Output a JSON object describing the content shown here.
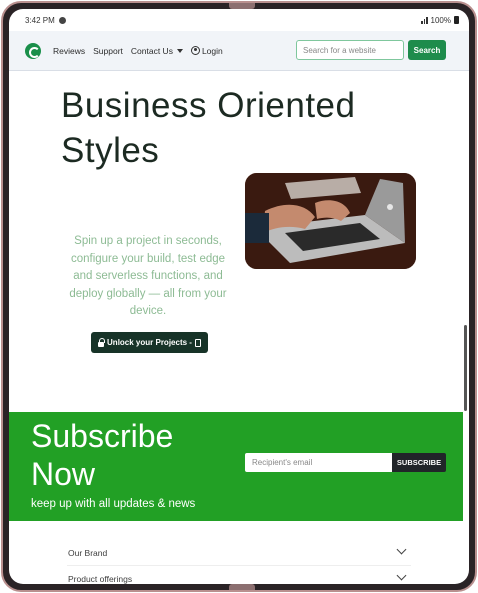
{
  "status_bar": {
    "time": "3:42 PM",
    "battery": "100%"
  },
  "navbar": {
    "links": [
      "Reviews",
      "Support",
      "Contact Us",
      "Login"
    ],
    "search_placeholder": "Search for a website",
    "search_button": "Search",
    "brand_color": "#1e8c4c"
  },
  "hero": {
    "title": "Business Oriented Styles",
    "body": "Spin up a project in seconds, configure your build, test edge and serverless functions, and deploy globally — all from your device.",
    "cta": "Unlock your Projects -",
    "image": "laptop-typing-photo"
  },
  "subscribe": {
    "title_line1": "Subscribe",
    "title_line2": "Now",
    "tagline": "keep up with all updates & news",
    "email_placeholder": "Recipient's email",
    "button": "SUBSCRIBE",
    "background": "#22a025"
  },
  "footer_accordion": [
    "Our Brand",
    "Product offerings"
  ]
}
